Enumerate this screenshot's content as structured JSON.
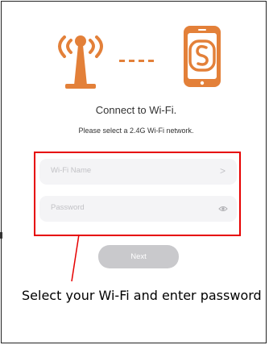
{
  "colors": {
    "accent": "#e38039",
    "highlight_border": "#e60000",
    "field_bg": "#f4f4f6",
    "placeholder_text": "#c2c2c6",
    "button_disabled": "#c9c9cc"
  },
  "header": {
    "title": "Connect to Wi-Fi.",
    "subtitle": "Please select a 2.4G Wi-Fi network."
  },
  "icons": {
    "router": "wifi-router-icon",
    "dashes": "connection-dashes-icon",
    "phone": "phone-app-icon"
  },
  "form": {
    "ssid_placeholder": "Wi-Fi Name",
    "ssid_chevron": ">",
    "password_placeholder": "Password",
    "password_toggle_icon": "eye-icon",
    "next_label": "Next"
  },
  "annotation": {
    "caption": "Select your Wi-Fi and enter password"
  }
}
